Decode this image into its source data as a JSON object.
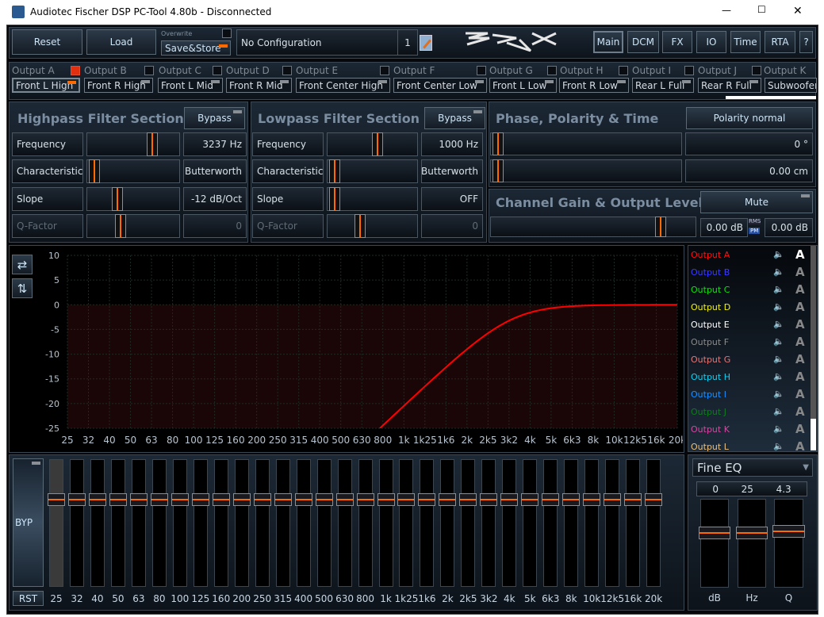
{
  "window": {
    "title": "Audiotec Fischer DSP PC-Tool 4.80b - Disconnected",
    "minimize": "—",
    "maximize": "☐",
    "close": "✕"
  },
  "toolbar": {
    "reset": "Reset",
    "load": "Load",
    "overwrite_label": "Overwrite",
    "save_store": "Save&Store",
    "config_name": "No Configuration",
    "config_slot": "1",
    "logo": "3RuX",
    "nav": [
      {
        "label": "Main",
        "selected": true
      },
      {
        "label": "DCM"
      },
      {
        "label": "FX"
      },
      {
        "label": "IO"
      },
      {
        "label": "Time"
      },
      {
        "label": "RTA"
      },
      {
        "label": "?"
      }
    ]
  },
  "outputs": [
    {
      "id": "Output A",
      "name": "Front L High",
      "checked": true,
      "selected": true
    },
    {
      "id": "Output B",
      "name": "Front R High"
    },
    {
      "id": "Output C",
      "name": "Front L Mid"
    },
    {
      "id": "Output D",
      "name": "Front R Mid"
    },
    {
      "id": "Output E",
      "name": "Front Center High"
    },
    {
      "id": "Output F",
      "name": "Front Center Low"
    },
    {
      "id": "Output G",
      "name": "Front L Low"
    },
    {
      "id": "Output H",
      "name": "Front R Low"
    },
    {
      "id": "Output I",
      "name": "Rear L Full"
    },
    {
      "id": "Output J",
      "name": "Rear R Full"
    },
    {
      "id": "Output K",
      "name": "Subwoofer"
    }
  ],
  "highpass": {
    "title": "Highpass Filter Section",
    "bypass": "Bypass",
    "rows": [
      {
        "label": "Frequency",
        "value": "3237 Hz"
      },
      {
        "label": "Characteristic",
        "value": "Butterworth"
      },
      {
        "label": "Slope",
        "value": "-12 dB/Oct"
      },
      {
        "label": "Q-Factor",
        "value": "0",
        "disabled": true
      }
    ]
  },
  "lowpass": {
    "title": "Lowpass Filter Section",
    "bypass": "Bypass",
    "rows": [
      {
        "label": "Frequency",
        "value": "1000 Hz"
      },
      {
        "label": "Characteristic",
        "value": "Butterworth"
      },
      {
        "label": "Slope",
        "value": "OFF"
      },
      {
        "label": "Q-Factor",
        "value": "0",
        "disabled": true
      }
    ]
  },
  "phase": {
    "title": "Phase, Polarity & Time",
    "polarity": "Polarity normal",
    "phase_value": "0 °",
    "time_value": "0.00 cm"
  },
  "gain": {
    "title": "Channel Gain & Output Level",
    "mute": "Mute",
    "gain_value": "0.00 dB",
    "rms": "RMS",
    "pm": "PM",
    "output_level": "0.00 dB"
  },
  "chart_data": {
    "type": "line",
    "ylim": [
      -25,
      10
    ],
    "yticks": [
      "10",
      "5",
      "0",
      "-5",
      "-10",
      "-15",
      "-20",
      "-25"
    ],
    "xticks": [
      "25",
      "32",
      "40",
      "50",
      "63",
      "80",
      "100",
      "125",
      "160",
      "200",
      "250",
      "315",
      "400",
      "500",
      "630",
      "800",
      "1k",
      "1k25",
      "1k6",
      "2k",
      "2k5",
      "3k2",
      "4k",
      "5k",
      "6k3",
      "8k",
      "10k",
      "12k5",
      "16k",
      "20k"
    ],
    "xscale": "log",
    "grid": true,
    "series": [
      {
        "name": "Output A",
        "color": "#ff0000",
        "highpass_hz": 3237,
        "slope_db_oct": -12
      }
    ]
  },
  "legend": [
    {
      "name": "Output A",
      "color": "#ff1010",
      "active": true
    },
    {
      "name": "Output B",
      "color": "#3a3aff"
    },
    {
      "name": "Output C",
      "color": "#10e010"
    },
    {
      "name": "Output D",
      "color": "#f0f010"
    },
    {
      "name": "Output E",
      "color": "#ffffff"
    },
    {
      "name": "Output F",
      "color": "#8a8a8a"
    },
    {
      "name": "Output G",
      "color": "#e07878"
    },
    {
      "name": "Output H",
      "color": "#10d0f0"
    },
    {
      "name": "Output I",
      "color": "#1890ff"
    },
    {
      "name": "Output J",
      "color": "#107a20"
    },
    {
      "name": "Output K",
      "color": "#d04aa0"
    },
    {
      "name": "Output L",
      "color": "#e8c080"
    }
  ],
  "legend_letter": "A",
  "eq": {
    "bypass": "BYP",
    "reset": "RST",
    "bands": [
      "25",
      "32",
      "40",
      "50",
      "63",
      "80",
      "100",
      "125",
      "160",
      "200",
      "250",
      "315",
      "400",
      "500",
      "630",
      "800",
      "1k",
      "1k25",
      "1k6",
      "2k",
      "2k5",
      "3k2",
      "4k",
      "5k",
      "6k3",
      "8k",
      "10k",
      "12k5",
      "16k",
      "20k"
    ],
    "gains_db": 0
  },
  "fine_eq": {
    "mode": "Fine EQ",
    "db": "0",
    "hz": "25",
    "q": "4.3",
    "labels": [
      "dB",
      "Hz",
      "Q"
    ]
  }
}
